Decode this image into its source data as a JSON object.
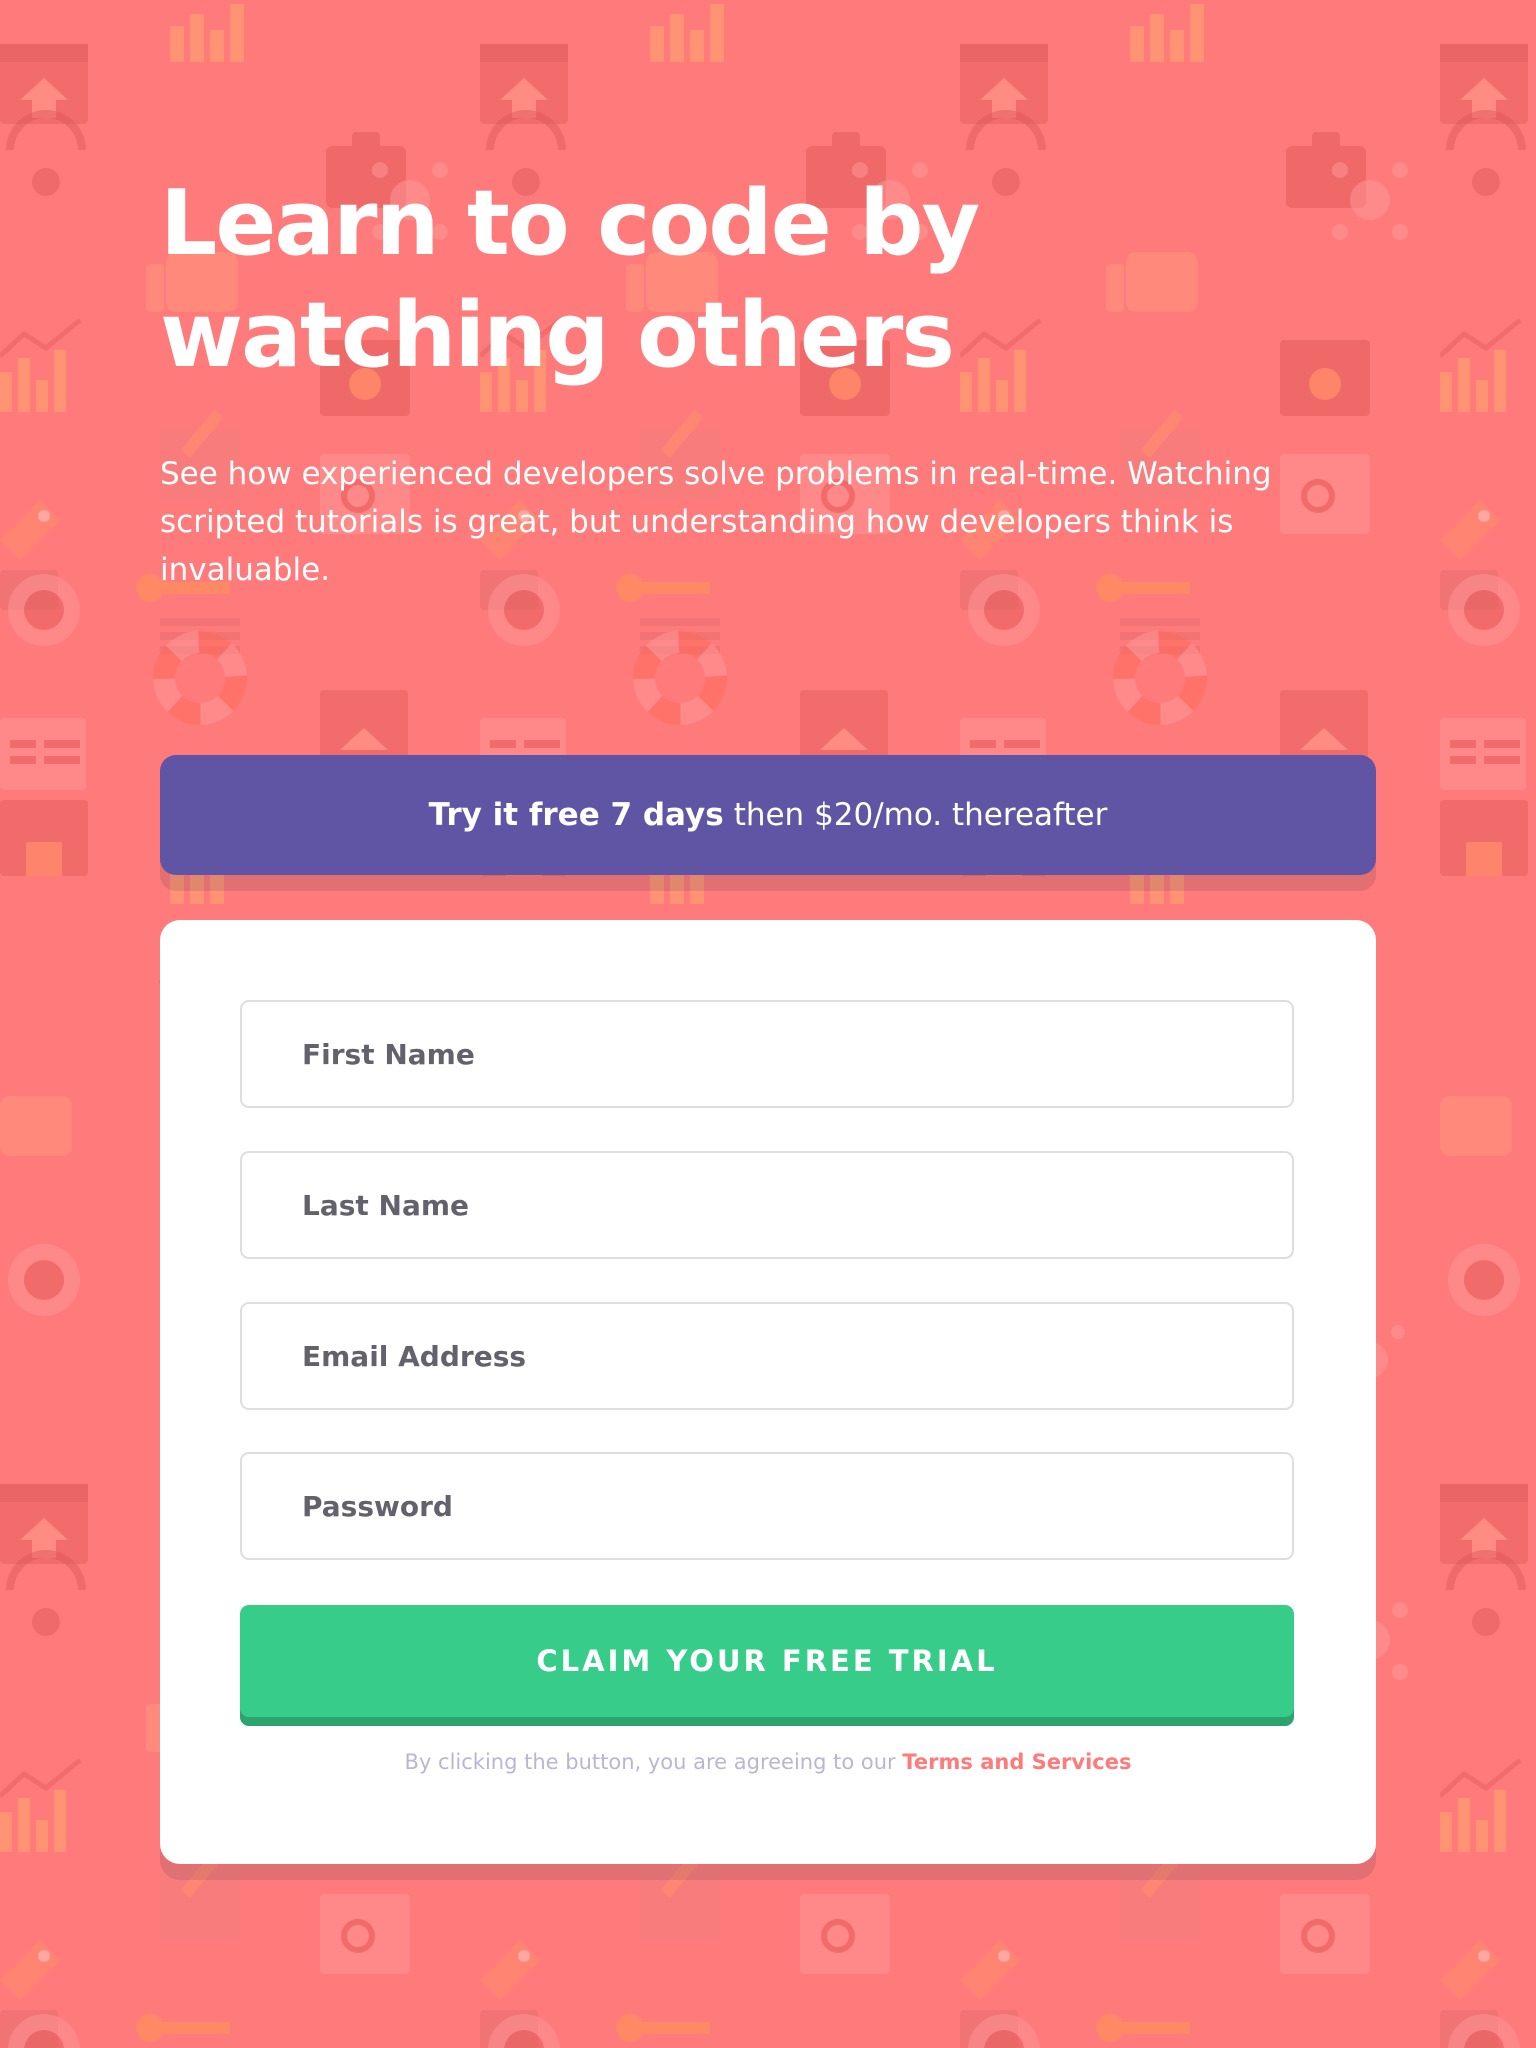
{
  "hero": {
    "title_line1": "Learn to code by",
    "title_line2": "watching others",
    "description": "See how experienced developers solve problems in real-time. Watching scripted tutorials is great, but understanding how developers think is invaluable."
  },
  "promo": {
    "bold_text": "Try it free 7 days",
    "rest_text": "then $20/mo. thereafter"
  },
  "form": {
    "first_name_placeholder": "First Name",
    "last_name_placeholder": "Last Name",
    "email_placeholder": "Email Address",
    "password_placeholder": "Password",
    "submit_label": "CLAIM YOUR FREE TRIAL",
    "terms_prefix": "By clicking the button, you are agreeing to our",
    "terms_link": "Terms and Services"
  },
  "colors": {
    "background": "#ff7a7a",
    "promo_bg": "#6055a5",
    "submit_bg": "#38cc8b",
    "terms_link": "#ff7a7a"
  }
}
